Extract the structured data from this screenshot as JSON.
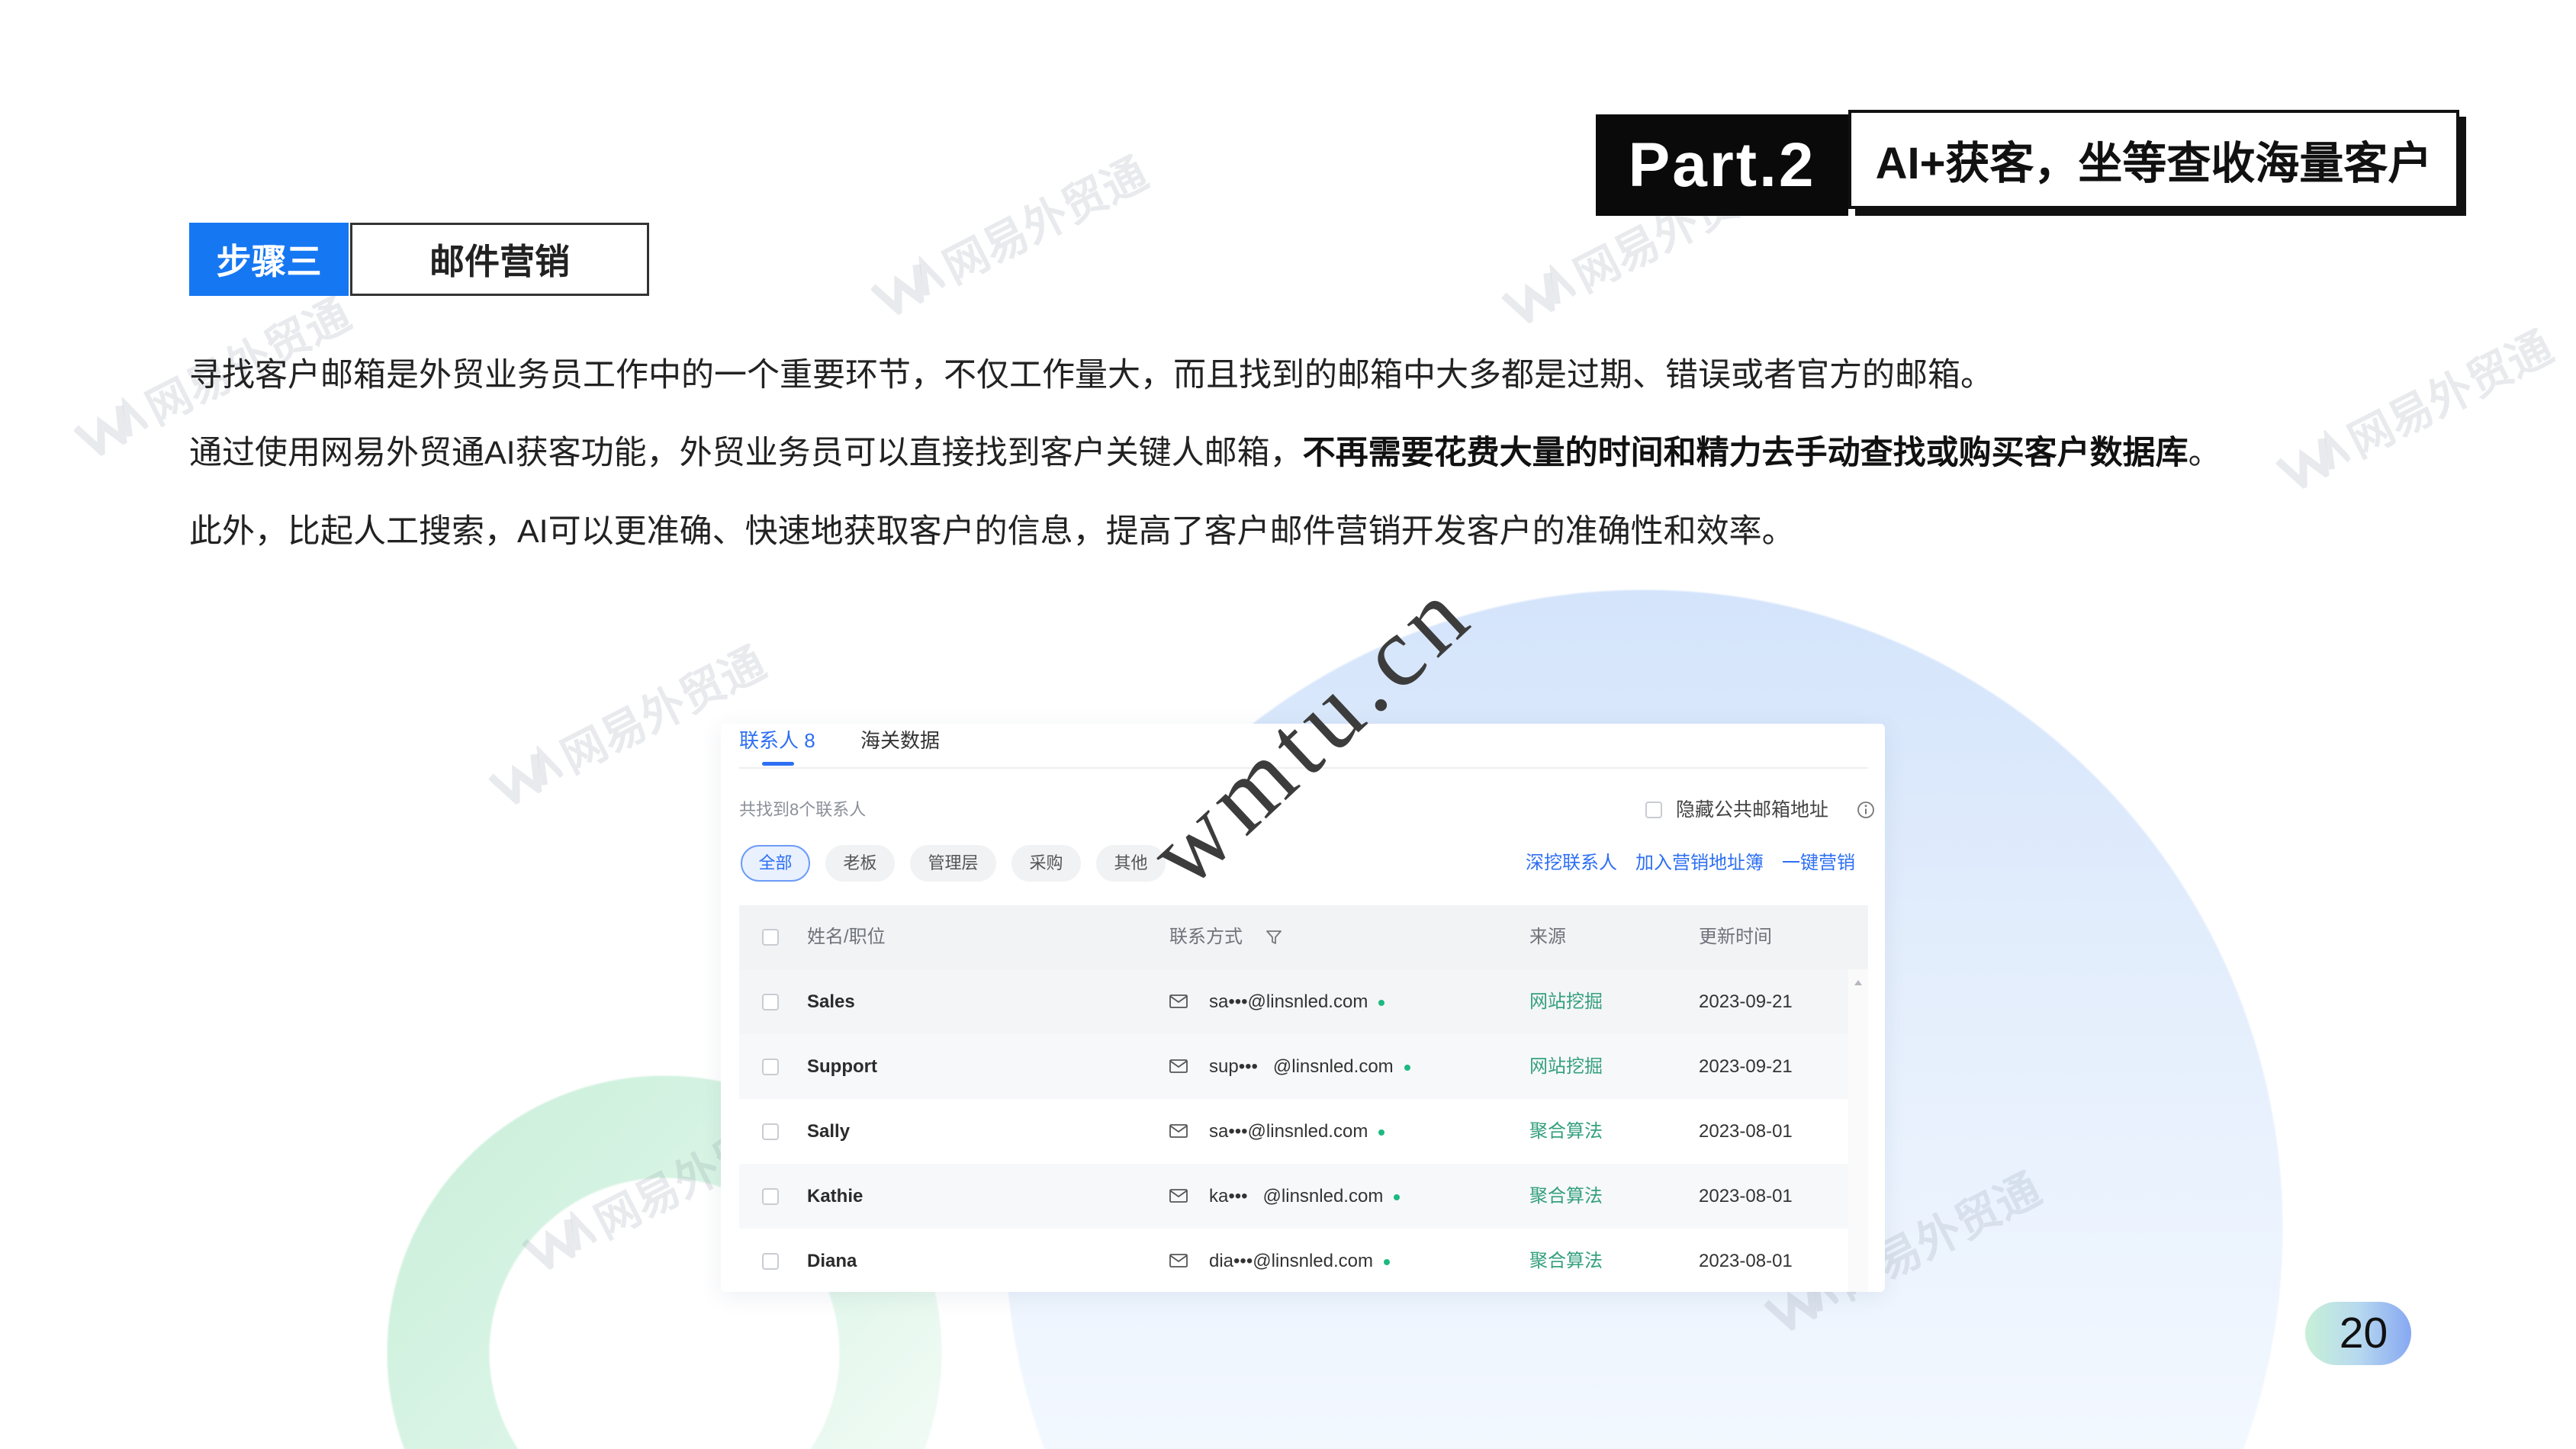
{
  "slide": {
    "header": {
      "part_label": "Part.2",
      "title": "AI+获客，坐等查收海量客户"
    },
    "step": {
      "label": "步骤三",
      "title": "邮件营销"
    },
    "paragraphs": {
      "line1": "寻找客户邮箱是外贸业务员工作中的一个重要环节，不仅工作量大，而且找到的邮箱中大多都是过期、错误或者官方的邮箱。",
      "line2": {
        "text": "通过使用网易外贸通AI获客功能，外贸业务员可以直接找到客户关键人邮箱，",
        "bold": "不再需要花费大量的时间和精力去手动查找或购买客户数据库",
        "end": "。"
      },
      "line3": "此外，比起人工搜索，AI可以更准确、快速地获取客户的信息，提高了客户邮件营销开发客户的准确性和效率。"
    },
    "page_number": "20"
  },
  "ui": {
    "tabs": [
      {
        "label": "联系人 8",
        "active": true
      },
      {
        "label": "海关数据",
        "active": false
      }
    ],
    "found_count": "共找到8个联系人",
    "hide_public": {
      "label": "隐藏公共邮箱地址",
      "checked": false
    },
    "filters": [
      {
        "label": "全部",
        "active": true
      },
      {
        "label": "老板",
        "active": false
      },
      {
        "label": "管理层",
        "active": false
      },
      {
        "label": "采购",
        "active": false
      },
      {
        "label": "其他",
        "active": false
      }
    ],
    "actions": [
      "深挖联系人",
      "加入营销地址簿",
      "一键营销"
    ],
    "columns": [
      "姓名/职位",
      "联系方式",
      "来源",
      "更新时间"
    ],
    "rows": [
      {
        "name": "Sales",
        "email": "sa•••@linsnled.com",
        "source": "网站挖掘",
        "date": "2023-09-21"
      },
      {
        "name": "Support",
        "email": "sup•••   @linsnled.com",
        "source": "网站挖掘",
        "date": "2023-09-21"
      },
      {
        "name": "Sally",
        "email": "sa•••@linsnled.com",
        "source": "聚合算法",
        "date": "2023-08-01"
      },
      {
        "name": "Kathie",
        "email": "ka•••   @linsnled.com",
        "source": "聚合算法",
        "date": "2023-08-01"
      },
      {
        "name": "Diana",
        "email": "dia•••@linsnled.com",
        "source": "聚合算法",
        "date": "2023-08-01"
      }
    ]
  },
  "watermarks": {
    "brand": "网易外贸通",
    "site": "wmtu.cn"
  },
  "icons": {
    "mail": "mail-icon",
    "filter": "filter-icon",
    "info": "info-icon",
    "checkbox": "checkbox-icon",
    "scroll_up": "chevron-up-icon",
    "brand_logo": "brand-logo-icon",
    "status_dot": "status-dot-icon"
  },
  "colors": {
    "header_black": "#0a0a0a",
    "step_blue": "#1677f2",
    "accent_blue": "#2d6ff3",
    "source_green": "#34a07e",
    "status_dot_green": "#1db980",
    "bg_circle_blue": "#d4e4fb",
    "bg_ring_green": "#c8eed8"
  }
}
